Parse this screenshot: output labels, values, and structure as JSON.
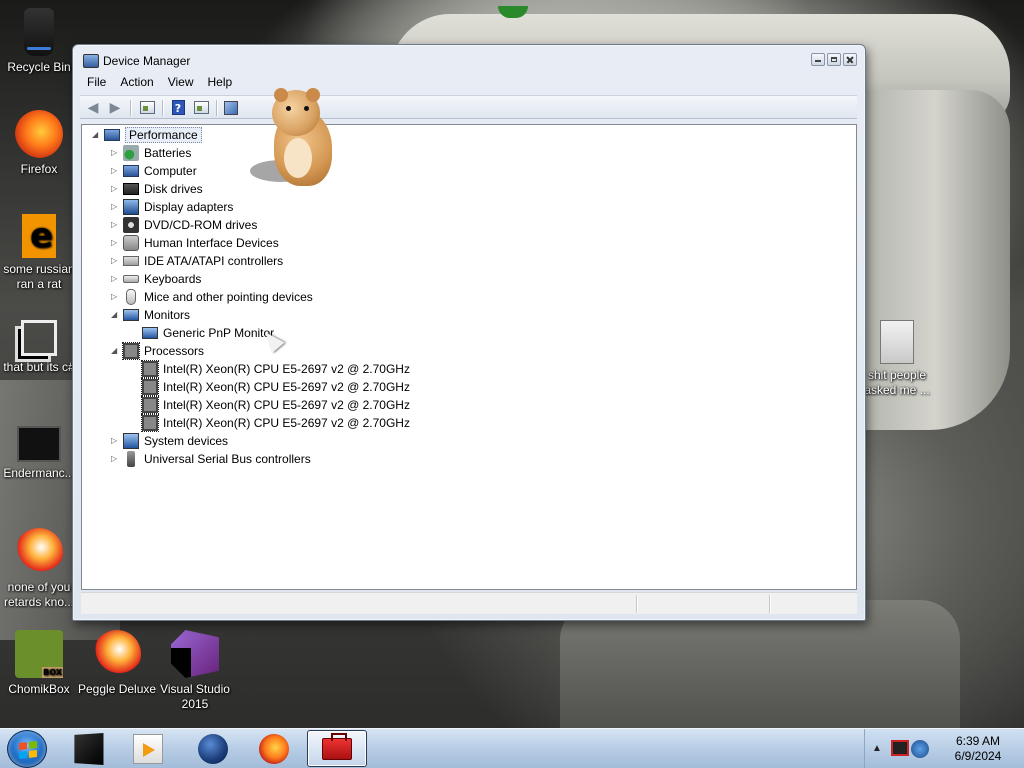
{
  "desktop": {
    "icons": [
      {
        "label": "Recycle Bin",
        "icon": "recycle-bin-icon"
      },
      {
        "label": "Firefox",
        "icon": "firefox-icon"
      },
      {
        "label": "some russian\nran a rat",
        "icon": "shortcut-icon"
      },
      {
        "label": "that but its c#",
        "icon": "stack-icon"
      },
      {
        "label": "Endermanc...",
        "icon": "terminal-icon"
      },
      {
        "label": "none of you\nretards kno...",
        "icon": "peggle-icon"
      },
      {
        "label": "ChomikBox",
        "icon": "chomikbox-icon"
      },
      {
        "label": "Peggle Deluxe",
        "icon": "peggle-icon"
      },
      {
        "label": "Visual Studio\n2015",
        "icon": "visual-studio-icon"
      },
      {
        "label": "shit people\nasked me ...",
        "icon": "file-icon"
      }
    ]
  },
  "window": {
    "title": "Device Manager",
    "menu": [
      "File",
      "Action",
      "View",
      "Help"
    ],
    "toolbar": [
      "back-icon",
      "forward-icon",
      "properties-icon",
      "help-icon",
      "show-hide-icon",
      "scan-hardware-icon"
    ],
    "tree": {
      "root": "Performance",
      "categories": [
        {
          "label": "Batteries",
          "icon": "battery-icon",
          "expanded": false
        },
        {
          "label": "Computer",
          "icon": "computer-icon",
          "expanded": false
        },
        {
          "label": "Disk drives",
          "icon": "disk-drive-icon",
          "expanded": false
        },
        {
          "label": "Display adapters",
          "icon": "display-adapter-icon",
          "expanded": false
        },
        {
          "label": "DVD/CD-ROM drives",
          "icon": "dvd-drive-icon",
          "expanded": false
        },
        {
          "label": "Human Interface Devices",
          "icon": "hid-icon",
          "expanded": false
        },
        {
          "label": "IDE ATA/ATAPI controllers",
          "icon": "ide-controller-icon",
          "expanded": false
        },
        {
          "label": "Keyboards",
          "icon": "keyboard-icon",
          "expanded": false
        },
        {
          "label": "Mice and other pointing devices",
          "icon": "mouse-icon",
          "expanded": false
        },
        {
          "label": "Monitors",
          "icon": "monitor-icon",
          "expanded": true,
          "children": [
            "Generic PnP Monitor"
          ]
        },
        {
          "label": "Processors",
          "icon": "processor-icon",
          "expanded": true,
          "children": [
            "Intel(R) Xeon(R) CPU E5-2697 v2 @ 2.70GHz",
            "Intel(R) Xeon(R) CPU E5-2697 v2 @ 2.70GHz",
            "Intel(R) Xeon(R) CPU E5-2697 v2 @ 2.70GHz",
            "Intel(R) Xeon(R) CPU E5-2697 v2 @ 2.70GHz"
          ]
        },
        {
          "label": "System devices",
          "icon": "system-device-icon",
          "expanded": false
        },
        {
          "label": "Universal Serial Bus controllers",
          "icon": "usb-icon",
          "expanded": false
        }
      ]
    }
  },
  "taskbar": {
    "items": [
      "media-center-icon",
      "media-player-icon",
      "globe-browser-icon",
      "firefox-icon",
      "toolbox-icon"
    ],
    "active_item": "toolbox-icon",
    "time": "6:39 AM",
    "date": "6/9/2024"
  },
  "colors": {
    "taskbar": "#b7cde6",
    "window_chrome": "#dfe6f0",
    "selection": "#e8eef7"
  }
}
